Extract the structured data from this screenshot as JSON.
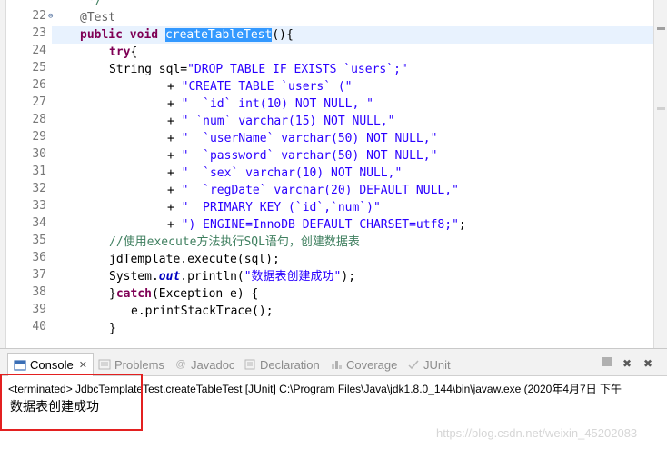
{
  "editor": {
    "lines": [
      {
        "number": "",
        "text": "*/",
        "fold": false
      },
      {
        "number": "22",
        "text": "@Test",
        "fold": true
      },
      {
        "number": "23",
        "text": "public void createTableTest(){",
        "fold": false
      },
      {
        "number": "24",
        "text": "try{",
        "fold": false
      },
      {
        "number": "25",
        "text": "String sql=\"DROP TABLE IF EXISTS `users`;\"",
        "fold": false
      },
      {
        "number": "26",
        "text": "+ \"CREATE TABLE `users` (\"",
        "fold": false
      },
      {
        "number": "27",
        "text": "+ \"  `id` int(10) NOT NULL, \"",
        "fold": false
      },
      {
        "number": "28",
        "text": "+ \" `num` varchar(15) NOT NULL,\"",
        "fold": false
      },
      {
        "number": "29",
        "text": "+ \"  `userName` varchar(50) NOT NULL,\"",
        "fold": false
      },
      {
        "number": "30",
        "text": "+ \"  `password` varchar(50) NOT NULL,\"",
        "fold": false
      },
      {
        "number": "31",
        "text": "+ \"  `sex` varchar(10) NOT NULL,\"",
        "fold": false
      },
      {
        "number": "32",
        "text": "+ \"  `regDate` varchar(20) DEFAULT NULL,\"",
        "fold": false
      },
      {
        "number": "33",
        "text": "+ \"  PRIMARY KEY (`id`,`num`)\"",
        "fold": false
      },
      {
        "number": "34",
        "text": "+ \") ENGINE=InnoDB DEFAULT CHARSET=utf8;\";",
        "fold": false
      },
      {
        "number": "35",
        "text": "//使用execute方法执行SQL语句，创建数据表",
        "fold": false
      },
      {
        "number": "36",
        "text": "jdTemplate.execute(sql);",
        "fold": false
      },
      {
        "number": "37",
        "text": "System.out.println(\"数据表创建成功\");",
        "fold": false
      },
      {
        "number": "38",
        "text": "}catch(Exception e) {",
        "fold": false
      },
      {
        "number": "39",
        "text": "e.printStackTrace();",
        "fold": false
      },
      {
        "number": "40",
        "text": "}",
        "fold": false
      }
    ],
    "selected_word": "createTableTest",
    "current_line": "23"
  },
  "console": {
    "tabs": [
      {
        "label": "Console",
        "icon": "console-icon",
        "active": true
      },
      {
        "label": "Problems",
        "icon": "problems-icon",
        "active": false
      },
      {
        "label": "Javadoc",
        "icon": "javadoc-icon",
        "active": false
      },
      {
        "label": "Declaration",
        "icon": "declaration-icon",
        "active": false
      },
      {
        "label": "Coverage",
        "icon": "coverage-icon",
        "active": false
      },
      {
        "label": "JUnit",
        "icon": "junit-icon",
        "active": false
      }
    ],
    "toolbar_icons": [
      "terminate-icon",
      "remove-launch-icon",
      "remove-all-launches-icon"
    ],
    "terminated_text": "<terminated> JdbcTemplateTest.createTableTest [JUnit] C:\\Program Files\\Java\\jdk1.8.0_144\\bin\\javaw.exe (2020年4月7日 下午",
    "output_text": "数据表创建成功",
    "watermark": "https://blog.csdn.net/weixin_45202083"
  },
  "colors": {
    "keyword": "#7f0055",
    "string": "#2a00ff",
    "comment": "#3f7f5f",
    "selection": "#3399ff",
    "current_line": "#e8f2fe",
    "annotation_box": "#e32020"
  }
}
